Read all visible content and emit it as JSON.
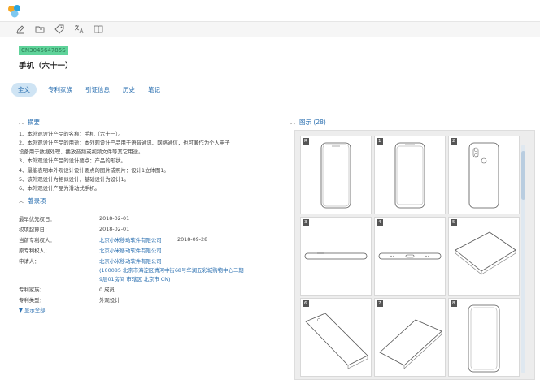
{
  "header": {
    "publication_number": "CN304564785S",
    "title": "手机（六十一）"
  },
  "toolbar": {
    "icons": [
      "pencil-icon",
      "folder-icon",
      "tag-icon",
      "translate-icon",
      "book-icon"
    ]
  },
  "tabs": [
    {
      "label": "全文",
      "active": true
    },
    {
      "label": "专利家族"
    },
    {
      "label": "引证信息"
    },
    {
      "label": "历史"
    },
    {
      "label": "笔记"
    }
  ],
  "abstract": {
    "heading": "摘要",
    "lines": [
      "1、本外观设计产品的名称：手机（六十一）。",
      "2、本外观设计产品的用途：本外观设计产品用于语音通讯、网络通信，也可兼作为个人电子",
      "设备用于数据处理、播放音频或视频文件等其它用途。",
      "3、本外观设计产品的设计要点：产品的形状。",
      "4、最能表明本外观设计设计要点的图片或照片：设计1立体图1。",
      "5、该外观设计为相似设计，基础设计为设计1。",
      "6、本外观设计产品为滑动式手机。"
    ]
  },
  "biblio": {
    "heading": "著录项",
    "rows": [
      {
        "label": "最早优先权日：",
        "value": "2018-02-01"
      },
      {
        "label": "权项起算日：",
        "value": "2018-02-01"
      },
      {
        "label": "当前专利权人：",
        "value": "北京小米移动软件有限公司",
        "extra": "2018-09-28"
      },
      {
        "label": "原专利权人：",
        "value": "北京小米移动软件有限公司"
      },
      {
        "label": "申请人：",
        "value": "北京小米移动软件有限公司",
        "addr1": "(100085 北京市海淀区清河中街68号华润五彩城购物中心二期",
        "addr2": "9层01房间 市辖区 北京市 CN)"
      },
      {
        "label": "专利家族：",
        "value": "0 成员"
      },
      {
        "label": "专利类型：",
        "value": "外观设计"
      }
    ],
    "show_all": "显示全部"
  },
  "figures": {
    "heading": "图示 (28)",
    "labels": [
      "R",
      "1",
      "2",
      "3",
      "4",
      "5",
      "6",
      "7",
      "8"
    ]
  }
}
